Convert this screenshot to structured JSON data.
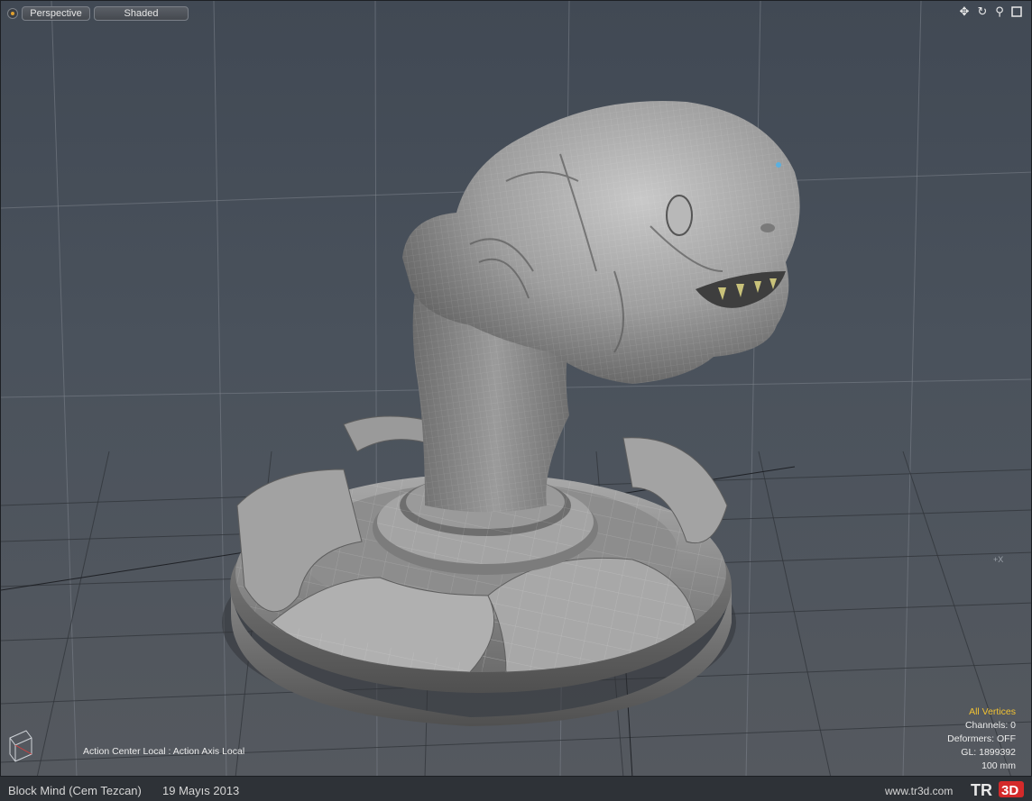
{
  "viewport": {
    "projection_label": "Perspective",
    "shading_label": "Shaded"
  },
  "nav_icons": [
    "move-view-icon",
    "rotate-view-icon",
    "zoom-view-icon",
    "maximize-view-icon"
  ],
  "hud": {
    "selection_mode": "All Vertices",
    "channels": "Channels: 0",
    "deformers": "Deformers: OFF",
    "gl_count": "GL: 1899392",
    "grid_scale": "100 mm",
    "action_center": "Action Center Local : Action Axis Local",
    "axis_label": "+X"
  },
  "footer": {
    "credit": "Block Mind (Cem Tezcan)",
    "date": "19 Mayıs 2013",
    "website": "www.tr3d.com",
    "logo_text": "TR3D"
  },
  "colors": {
    "selection_highlight": "#f2c233",
    "logo_red": "#d42a2a"
  }
}
